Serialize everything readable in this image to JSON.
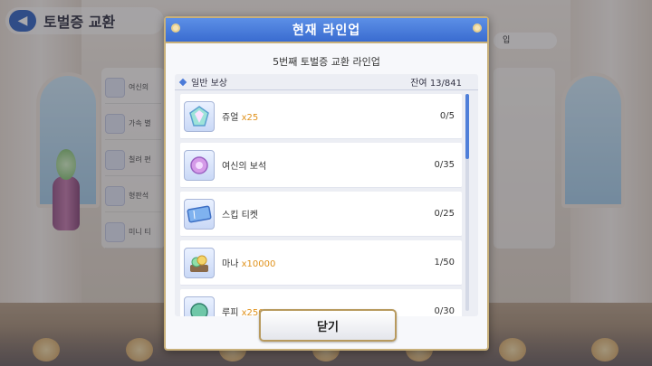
{
  "background": {
    "screen_title": "토벌증 교환",
    "back_icon": "back-arrow-icon",
    "side_items": [
      "여신의",
      "가속 별",
      "칠려 편",
      "형판석",
      "미니 티"
    ],
    "right_chip": "입",
    "bottom_nav": [
      "",
      "",
      "",
      "",
      "",
      "",
      ""
    ]
  },
  "modal": {
    "title": "현재 라인업",
    "subtitle": "5번째 토벌증 교환 라인업",
    "section_label": "일반 보상",
    "remaining": "잔여 13/841",
    "close_label": "닫기",
    "items": [
      {
        "name": "쥬얼",
        "qty": "x25",
        "count": "0/5",
        "icon": "jewel-icon"
      },
      {
        "name": "여신의 보석",
        "qty": "",
        "count": "0/35",
        "icon": "goddess-gem-icon"
      },
      {
        "name": "스킵 티켓",
        "qty": "",
        "count": "0/25",
        "icon": "skip-ticket-icon"
      },
      {
        "name": "마나",
        "qty": "x10000",
        "count": "1/50",
        "icon": "mana-icon"
      },
      {
        "name": "루피",
        "qty": "x250",
        "count": "0/30",
        "icon": "rupee-icon"
      }
    ]
  },
  "colors": {
    "header_blue": "#3a6cd0",
    "accent_orange": "#e0921c",
    "gold_border": "#c8b07a"
  }
}
